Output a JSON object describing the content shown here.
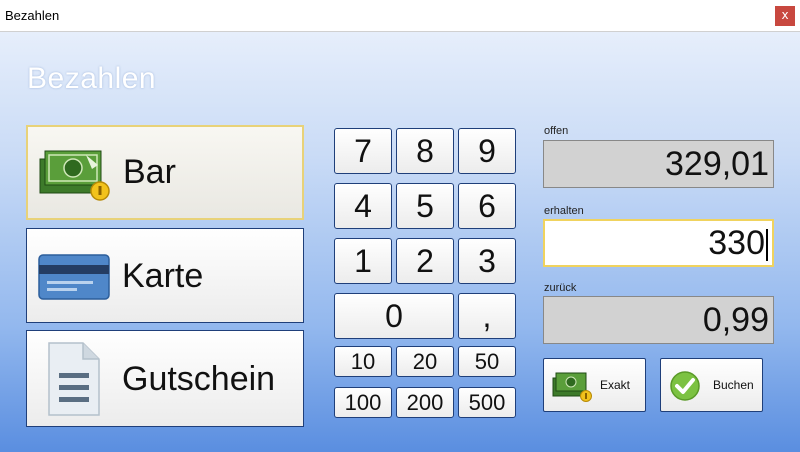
{
  "window": {
    "title": "Bezahlen",
    "close_glyph": "x"
  },
  "heading": "Bezahlen",
  "payment_methods": [
    {
      "label": "Bar",
      "icon": "cash-icon"
    },
    {
      "label": "Karte",
      "icon": "credit-card-icon"
    },
    {
      "label": "Gutschein",
      "icon": "voucher-document-icon"
    }
  ],
  "keypad": {
    "digits": [
      "7",
      "8",
      "9",
      "4",
      "5",
      "6",
      "1",
      "2",
      "3",
      "0",
      ","
    ],
    "amounts": [
      "10",
      "20",
      "50",
      "100",
      "200",
      "500"
    ]
  },
  "fields": {
    "offen": {
      "label": "offen",
      "value": "329,01"
    },
    "erhalten": {
      "label": "erhalten",
      "value": "330"
    },
    "zurueck": {
      "label": "zurück",
      "value": "0,99"
    }
  },
  "actions": {
    "exakt": {
      "label": "Exakt",
      "icon": "cash-icon"
    },
    "buchen": {
      "label": "Buchen",
      "icon": "checkmark-icon"
    }
  },
  "colors": {
    "gradient_top": "#e6eefb",
    "gradient_bottom": "#5a8ee0",
    "button_border": "#1f3f7a",
    "active_border": "#e8d279",
    "close_button": "#c8483f",
    "checkmark": "#7cc242"
  }
}
